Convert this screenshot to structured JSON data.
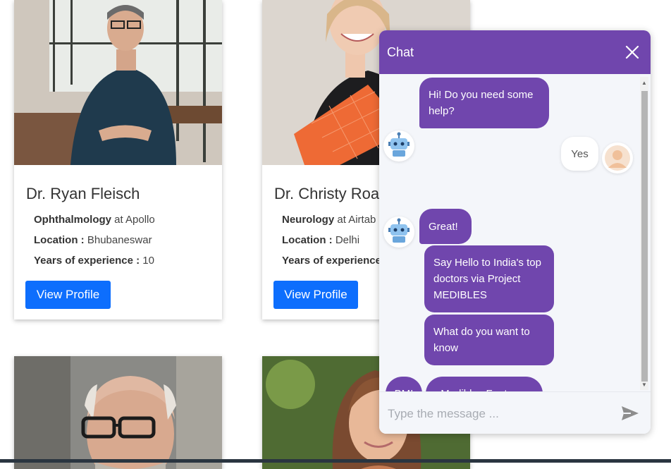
{
  "cards": [
    {
      "name": "Dr. Ryan Fleisch",
      "specialty": "Ophthalmology",
      "hospital_prefix": "at",
      "hospital": "Apollo",
      "location_label": "Location :",
      "location": "Bhubaneswar",
      "experience_label": "Years of experience :",
      "experience": "10",
      "button": "View Profile"
    },
    {
      "name": "Dr. Christy Roach",
      "specialty": "Neurology",
      "hospital_prefix": "at",
      "hospital": "Airtab",
      "location_label": "Location :",
      "location": "Delhi",
      "experience_label": "Years of experience :",
      "experience": "",
      "button": "View Profile"
    }
  ],
  "chat": {
    "title": "Chat",
    "messages": [
      {
        "from": "bot",
        "text": "Hi! Do you need some help?"
      },
      {
        "from": "user",
        "text": "Yes"
      },
      {
        "from": "bot",
        "text": "Great!"
      },
      {
        "from": "bot",
        "text": "Say Hello to India's top doctors via Project MEDIBLES"
      },
      {
        "from": "bot",
        "text": "What do you want to know"
      }
    ],
    "quick_replies": [
      "BMI",
      "Medibles Features"
    ],
    "input_placeholder": "Type the message ...",
    "icons": {
      "close": "close-icon",
      "send": "send-icon",
      "bot_avatar": "robot-icon",
      "user_avatar": "user-icon"
    }
  },
  "colors": {
    "chat_accent": "#7046ad",
    "button_primary": "#0d6efd"
  }
}
